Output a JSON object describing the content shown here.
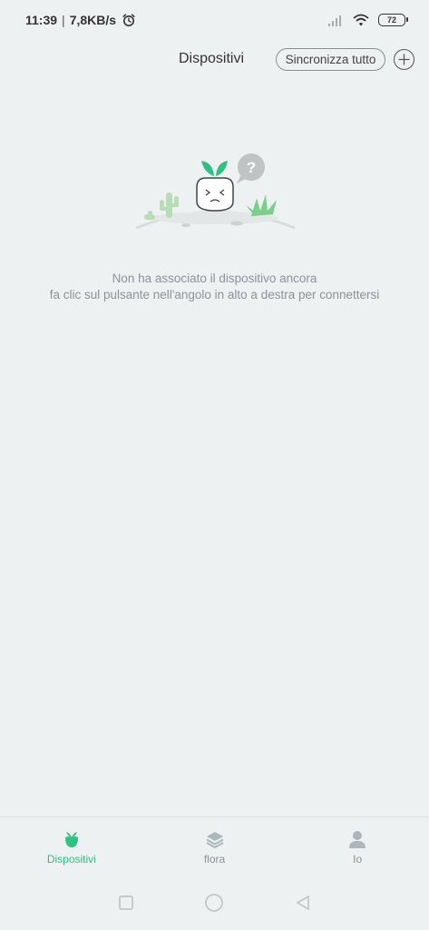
{
  "status_bar": {
    "time": "11:39",
    "separator": "|",
    "speed": "7,8KB/s",
    "battery": "72",
    "icons": [
      "alarm-icon",
      "signal-icon",
      "wifi-icon",
      "battery-icon"
    ]
  },
  "header": {
    "title": "Dispositivi",
    "sync_label": "Sincronizza tutto",
    "add_icon": "plus-circle-icon"
  },
  "empty_state": {
    "line1": "Non ha associato il dispositivo ancora",
    "line2": "fa clic sul pulsante nell'angolo in alto a destra per connettersi",
    "illustration": "sad-plant-with-question-mark"
  },
  "bottom_nav": {
    "items": [
      {
        "label": "Dispositivi",
        "icon": "plant-pot-icon",
        "active": true
      },
      {
        "label": "flora",
        "icon": "layers-icon",
        "active": false
      },
      {
        "label": "Io",
        "icon": "person-icon",
        "active": false
      }
    ]
  },
  "colors": {
    "background": "#eef1f1",
    "accent": "#2fc184",
    "muted_text": "#8e9294"
  },
  "system_nav": [
    "square-icon",
    "circle-icon",
    "back-triangle-icon"
  ]
}
